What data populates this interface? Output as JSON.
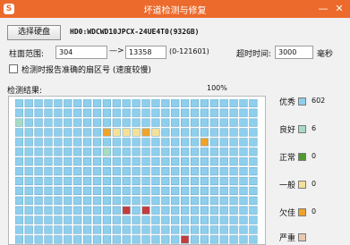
{
  "window": {
    "title": "坏道检测与修复",
    "app_icon": "S",
    "minimize_icon": "—",
    "close_icon": "✕"
  },
  "disk": {
    "select_button": "选择硬盘",
    "name": "HD0:WDCWD10JPCX-24UE4T0(932GB)"
  },
  "cylinder": {
    "label": "柱面范围:",
    "from": "304",
    "arrow": "—>",
    "to": "13358",
    "range_hint": "(0-121601)"
  },
  "timeout": {
    "label": "超时时间:",
    "value": "3000",
    "unit": "毫秒"
  },
  "option": {
    "report_sector_label": "检测时报告准确的扇区号 (速度较慢)"
  },
  "results": {
    "label": "检测结果:",
    "progress": "100%",
    "progress_value": 1.0
  },
  "legend": [
    {
      "label": "优秀",
      "count": "602",
      "color": "#8fcfee"
    },
    {
      "label": "良好",
      "count": "6",
      "color": "#a7dcc4"
    },
    {
      "label": "正常",
      "count": "0",
      "color": "#4f9a2e"
    },
    {
      "label": "一般",
      "count": "0",
      "color": "#f5e09a"
    },
    {
      "label": "欠佳",
      "count": "0",
      "color": "#f0a22a"
    },
    {
      "label": "严重",
      "count": "",
      "color": "#e8c9b0"
    }
  ],
  "grid": {
    "columns": 25,
    "rows": 15,
    "colors": {
      "excellent": "#8fcfee",
      "good": "#a7dcc4",
      "fair": "#f5e09a",
      "poor": "#f0a22a",
      "bad": "#c43c3c"
    },
    "special_cells": [
      {
        "row": 2,
        "col": 0,
        "state": "good"
      },
      {
        "row": 3,
        "col": 9,
        "state": "poor"
      },
      {
        "row": 3,
        "col": 10,
        "state": "fair"
      },
      {
        "row": 3,
        "col": 11,
        "state": "fair"
      },
      {
        "row": 3,
        "col": 12,
        "state": "fair"
      },
      {
        "row": 3,
        "col": 13,
        "state": "poor"
      },
      {
        "row": 3,
        "col": 14,
        "state": "fair"
      },
      {
        "row": 4,
        "col": 19,
        "state": "poor"
      },
      {
        "row": 5,
        "col": 9,
        "state": "good"
      },
      {
        "row": 11,
        "col": 11,
        "state": "bad"
      },
      {
        "row": 11,
        "col": 13,
        "state": "bad"
      },
      {
        "row": 14,
        "col": 17,
        "state": "bad"
      }
    ]
  }
}
